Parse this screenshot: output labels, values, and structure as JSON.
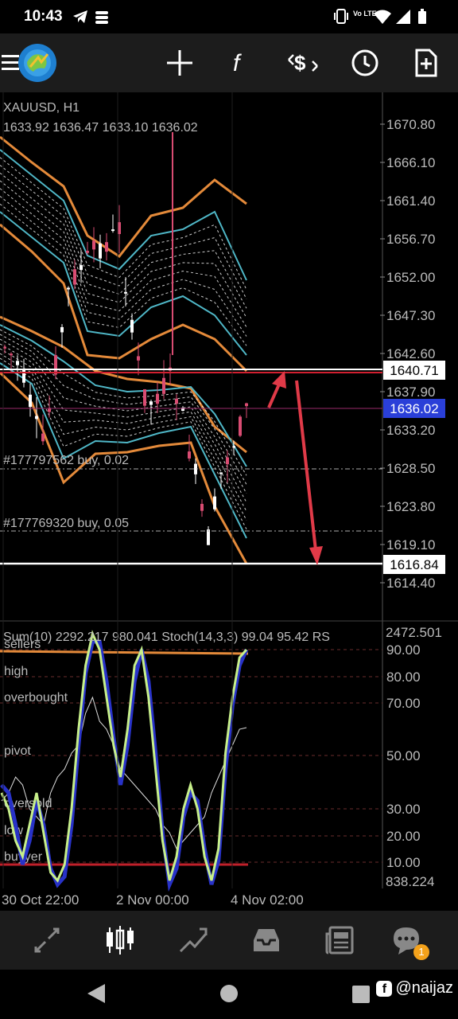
{
  "status_bar": {
    "time": "10:43",
    "network_label": "Vo LTE",
    "icons": [
      "telegram-icon",
      "storage-icon",
      "vibrate-icon",
      "wifi-icon",
      "signal-icon",
      "battery-icon"
    ]
  },
  "toolbar": {
    "icons": [
      "menu-icon",
      "mt-logo-icon",
      "crosshair-icon",
      "function-icon",
      "trade-icon",
      "clock-icon",
      "new-file-icon"
    ]
  },
  "chart": {
    "symbol_header": "XAUUSD, H1",
    "ohlc_header": "1633.92 1636.47 1633.10 1636.02",
    "price_ticks": [
      "1670.80",
      "1666.10",
      "1661.40",
      "1656.70",
      "1652.00",
      "1647.30",
      "1642.60",
      "1637.90",
      "1633.20",
      "1628.50",
      "1623.80",
      "1619.10",
      "1614.40"
    ],
    "level_resistance": "1640.71",
    "level_current": "1636.02",
    "level_support": "1616.84",
    "order_1": "#177797562 buy, 0.02",
    "order_2": "#177769320 buy, 0.05",
    "time_labels": [
      "30 Oct 22:00",
      "2 Nov 00:00",
      "4 Nov 02:00"
    ]
  },
  "indicator": {
    "header": "Sum(10) 2292.217 980.041 Stoch(14,3,3) 99.04 95.42 RS",
    "top_value": "2472.501",
    "bottom_value": "838.224",
    "ticks": [
      "90.00",
      "80.00",
      "70.00",
      "50.00",
      "30.00",
      "20.00",
      "10.00"
    ],
    "level_labels": [
      "sellers",
      "high",
      "overbought",
      "pivot",
      "oversold",
      "low",
      "buyyer"
    ]
  },
  "bottom_nav": {
    "items": [
      "quotes-icon",
      "chart-icon",
      "trade-icon",
      "history-icon",
      "news-icon",
      "chat-icon"
    ],
    "chat_badge": "1"
  },
  "system_nav": {
    "watermark": "@naijaz"
  },
  "colors": {
    "band_orange": "#e48a3a",
    "band_cyan": "#4fb7c7",
    "bull_candle": "#ffffff",
    "bear_candle": "#d94c72",
    "current_price_box": "#2a3fd8",
    "arrow_red": "#e03a48",
    "stoch_main": "#c7ef8a",
    "stoch_signal": "#2832c8"
  }
}
